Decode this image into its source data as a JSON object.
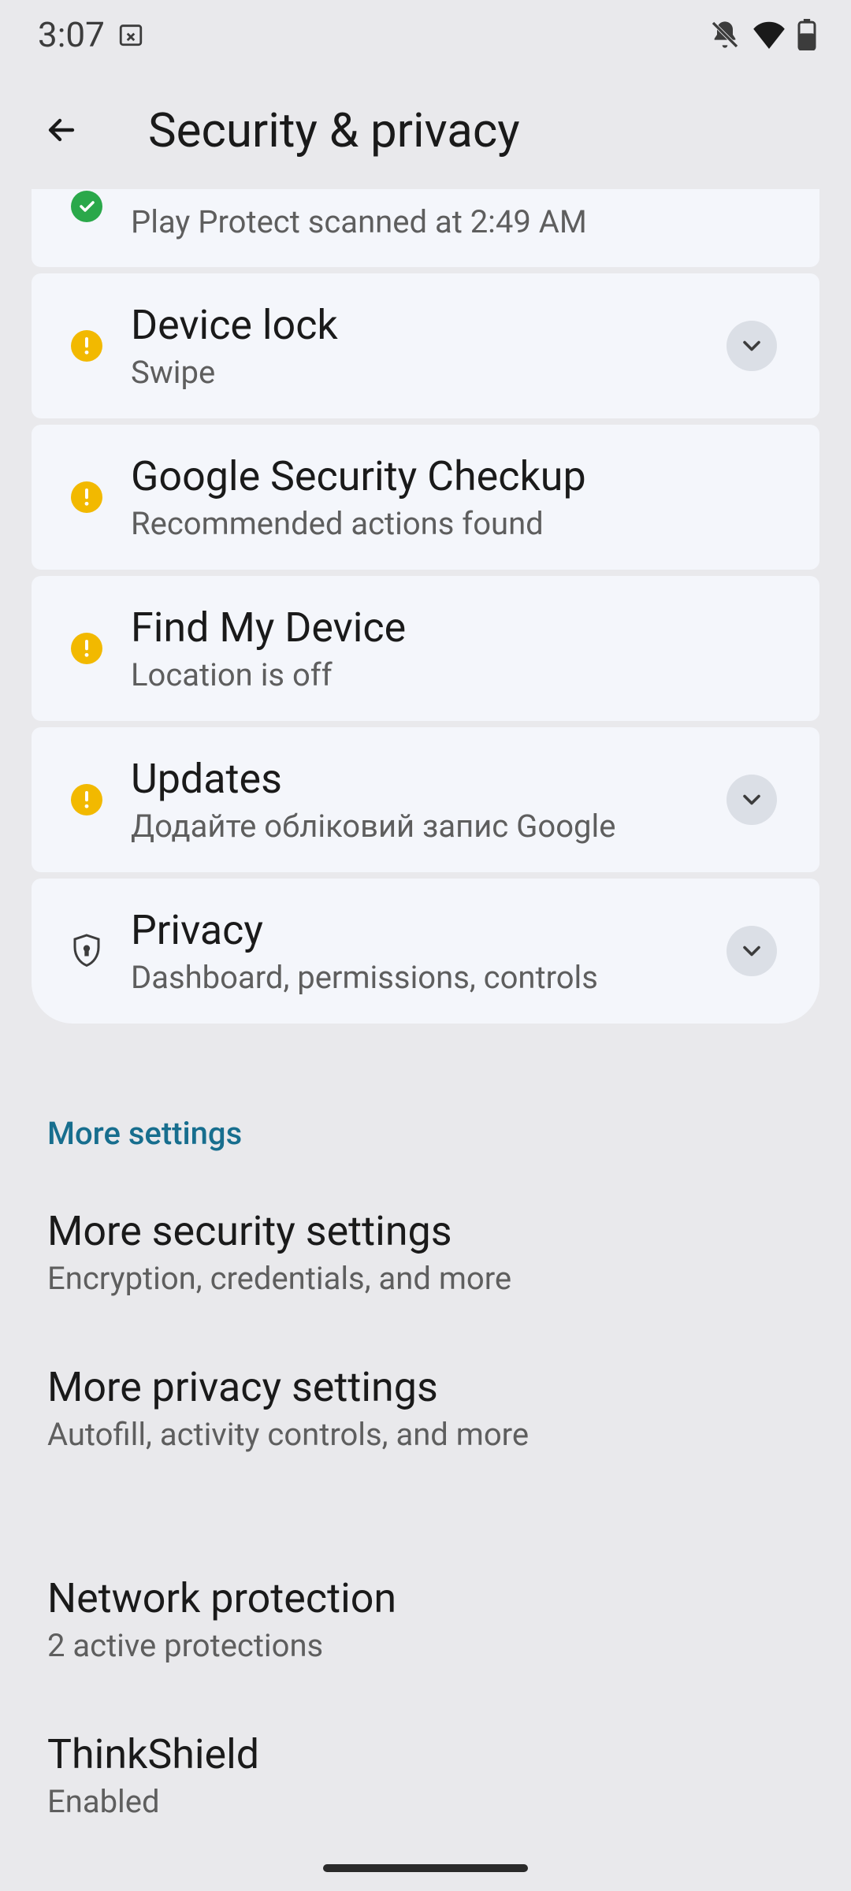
{
  "status": {
    "time": "3:07"
  },
  "app_bar": {
    "title": "Security & privacy"
  },
  "cards": {
    "app_security": {
      "sub": "Play Protect scanned at 2:49 AM"
    },
    "device_lock": {
      "title": "Device lock",
      "sub": "Swipe"
    },
    "security_checkup": {
      "title": "Google Security Checkup",
      "sub": "Recommended actions found"
    },
    "find_my_device": {
      "title": "Find My Device",
      "sub": "Location is off"
    },
    "updates": {
      "title": "Updates",
      "sub": "Додайте обліковий запис Google"
    },
    "privacy": {
      "title": "Privacy",
      "sub": "Dashboard, permissions, controls"
    }
  },
  "section_header": "More settings",
  "list": {
    "more_security": {
      "title": "More security settings",
      "sub": "Encryption, credentials, and more"
    },
    "more_privacy": {
      "title": "More privacy settings",
      "sub": "Autofill, activity controls, and more"
    },
    "network_protection": {
      "title": "Network protection",
      "sub": "2 active protections"
    },
    "thinkshield": {
      "title": "ThinkShield",
      "sub": "Enabled"
    }
  }
}
